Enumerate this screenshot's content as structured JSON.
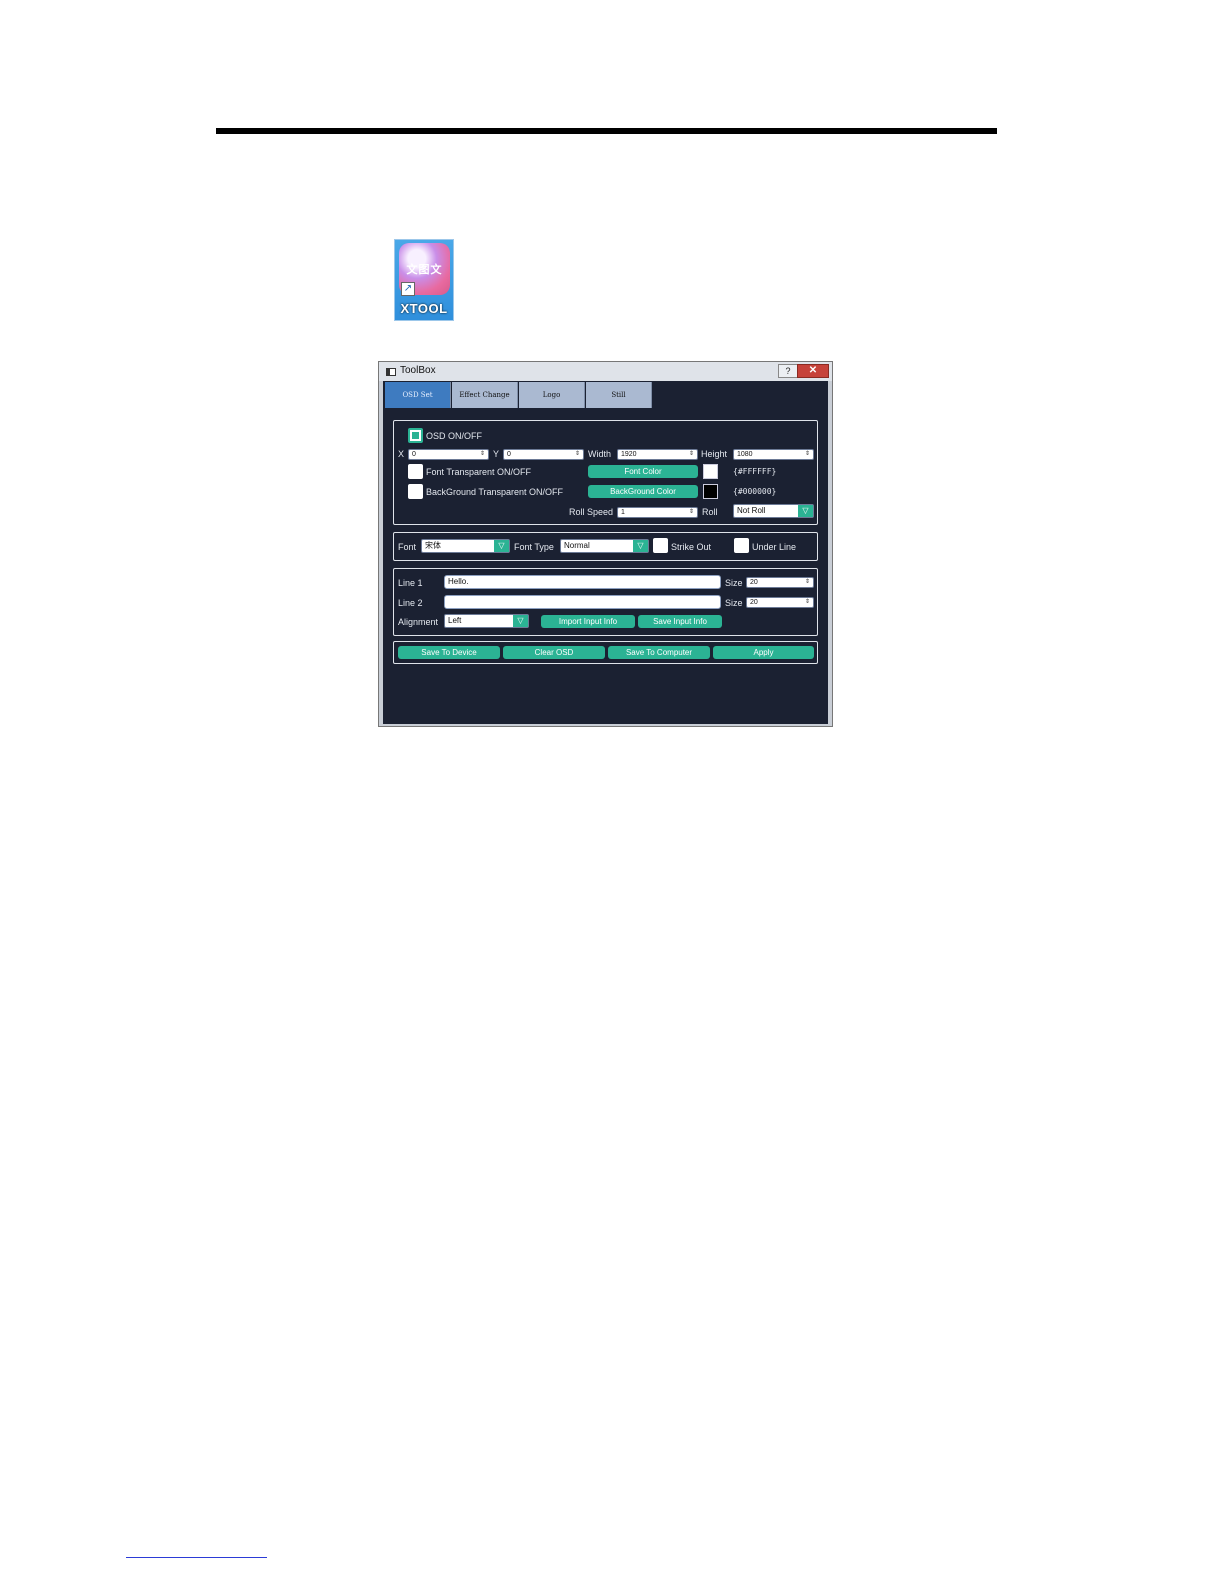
{
  "desktop": {
    "icon_label": "XTOOL",
    "icon_glyphs": "文图文",
    "shortcut_arrow": "↗"
  },
  "window": {
    "title": "ToolBox",
    "help_label": "?",
    "close_label": "✕"
  },
  "tabs": [
    {
      "label": "OSD Set",
      "active": true
    },
    {
      "label": "Effect Change",
      "active": false
    },
    {
      "label": "Logo",
      "active": false
    },
    {
      "label": "Still",
      "active": false
    }
  ],
  "osd": {
    "osd_on_label": "OSD ON/OFF",
    "osd_on_checked": true,
    "x_label": "X",
    "x_value": "0",
    "y_label": "Y",
    "y_value": "0",
    "width_label": "Width",
    "width_value": "1920",
    "height_label": "Height",
    "height_value": "1080",
    "font_transparent_label": "Font Transparent ON/OFF",
    "bg_transparent_label": "BackGround Transparent ON/OFF",
    "font_color_button": "Font Color",
    "font_color_hex": "{#FFFFFF}",
    "font_color_value": "#FFFFFF",
    "bg_color_button": "BackGround Color",
    "bg_color_hex": "{#000000}",
    "bg_color_value": "#000000",
    "roll_speed_label": "Roll Speed",
    "roll_speed_value": "1",
    "roll_label": "Roll",
    "roll_value": "Not Roll"
  },
  "font": {
    "font_label": "Font",
    "font_value": "宋体",
    "font_type_label": "Font Type",
    "font_type_value": "Normal",
    "strike_out_label": "Strike Out",
    "under_line_label": "Under Line"
  },
  "text": {
    "line1_label": "Line 1",
    "line1_value": "Hello.",
    "line2_label": "Line 2",
    "line2_value": "",
    "size_label": "Size",
    "size1_value": "20",
    "size2_value": "20",
    "alignment_label": "Alignment",
    "alignment_value": "Left",
    "import_button": "Import Input Info",
    "save_input_button": "Save Input Info"
  },
  "actions": {
    "save_device": "Save To Device",
    "clear_osd": "Clear OSD",
    "save_computer": "Save To Computer",
    "apply": "Apply"
  },
  "colors": {
    "accent": "#2bb394",
    "window_bg": "#1b2132",
    "tab_active": "#3e7bc0"
  },
  "icons": {
    "spin_arrows": "⇕",
    "dropdown": "▽"
  }
}
